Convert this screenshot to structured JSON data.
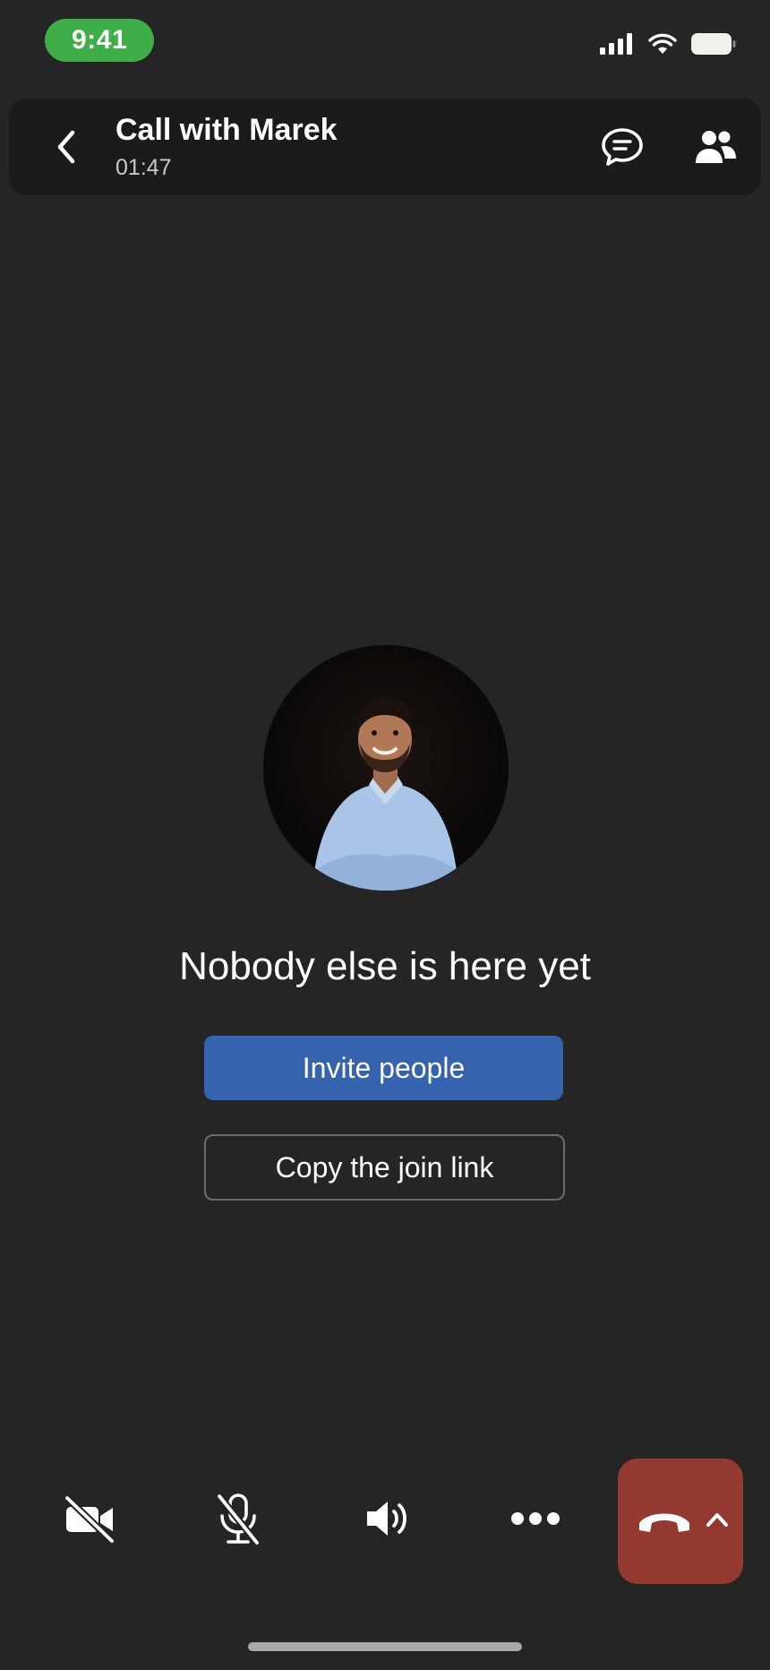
{
  "status_bar": {
    "time": "9:41",
    "signal_icon": "cellular-signal-icon",
    "wifi_icon": "wifi-icon",
    "battery_icon": "battery-icon",
    "time_pill_color": "#3fae49"
  },
  "header": {
    "back_icon": "chevron-left-icon",
    "title": "Call with Marek",
    "timer": "01:47",
    "chat_icon": "chat-bubble-icon",
    "people_icon": "people-icon"
  },
  "main": {
    "avatar_alt": "Participant photo",
    "message": "Nobody else is here yet",
    "invite_label": "Invite people",
    "copy_link_label": "Copy the join link",
    "invite_color": "#3563ad"
  },
  "controls": {
    "camera_icon": "camera-off-icon",
    "mic_icon": "mic-off-icon",
    "speaker_icon": "speaker-icon",
    "more_icon": "more-dots-icon",
    "end_call_icon": "hang-up-icon",
    "expand_icon": "chevron-up-icon",
    "end_call_color": "#93392f"
  }
}
